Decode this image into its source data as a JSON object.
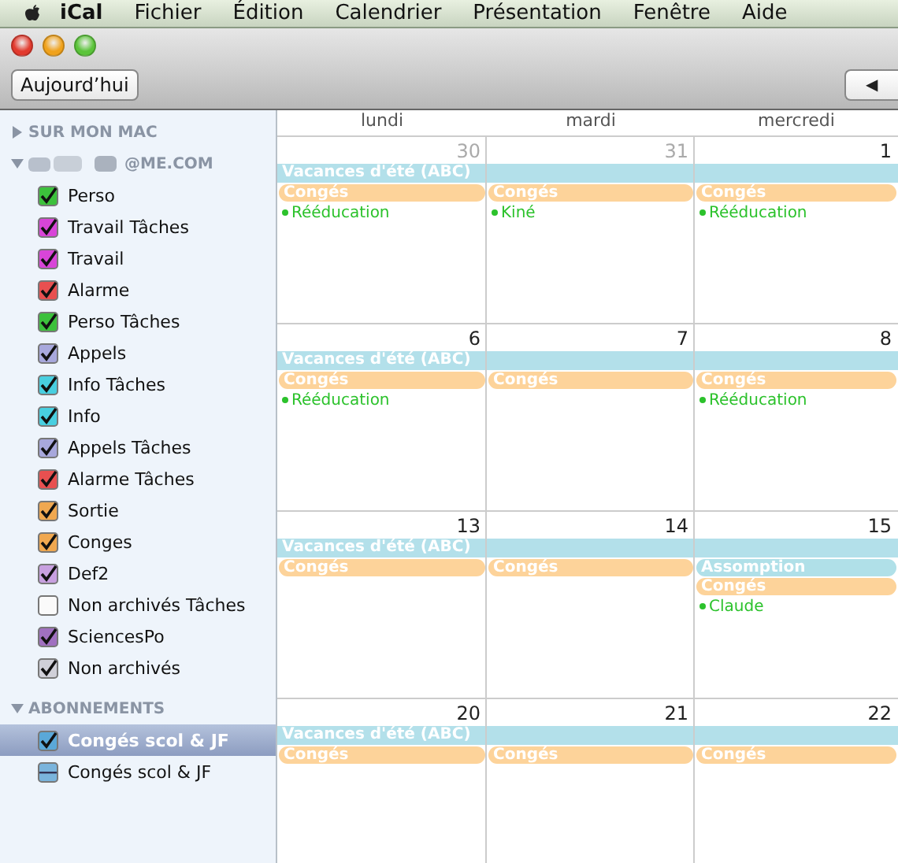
{
  "menubar": {
    "app": "iCal",
    "items": [
      "Fichier",
      "Édition",
      "Calendrier",
      "Présentation",
      "Fenêtre",
      "Aide"
    ]
  },
  "toolbar": {
    "today_button": "Aujourd’hui",
    "prev_button": "◀"
  },
  "sidebar": {
    "sections": [
      {
        "title": "SUR MON MAC",
        "expanded": false
      },
      {
        "title": "@ME.COM",
        "expanded": true,
        "redacted": true,
        "items": [
          {
            "label": "Perso",
            "color": "#3cc13c",
            "checked": true,
            "selected": false
          },
          {
            "label": "Travail Tâches",
            "color": "#d845d8",
            "checked": true,
            "selected": false
          },
          {
            "label": "Travail",
            "color": "#d845d8",
            "checked": true,
            "selected": false
          },
          {
            "label": "Alarme",
            "color": "#e85050",
            "checked": true,
            "selected": false
          },
          {
            "label": "Perso Tâches",
            "color": "#3cc13c",
            "checked": true,
            "selected": false
          },
          {
            "label": "Appels",
            "color": "#a8a8dc",
            "checked": true,
            "selected": false
          },
          {
            "label": "Info Tâches",
            "color": "#48cfe0",
            "checked": true,
            "selected": false
          },
          {
            "label": "Info",
            "color": "#48cfe0",
            "checked": true,
            "selected": false
          },
          {
            "label": "Appels Tâches",
            "color": "#a8a8dc",
            "checked": true,
            "selected": false
          },
          {
            "label": "Alarme Tâches",
            "color": "#e85050",
            "checked": true,
            "selected": false
          },
          {
            "label": "Sortie",
            "color": "#f0a850",
            "checked": true,
            "selected": false
          },
          {
            "label": "Conges",
            "color": "#f0a850",
            "checked": true,
            "selected": false
          },
          {
            "label": "Def2",
            "color": "#c8a0e0",
            "checked": true,
            "selected": false
          },
          {
            "label": "Non archivés Tâches",
            "checked": false,
            "selected": false
          },
          {
            "label": "SciencesPo",
            "color": "#a070c0",
            "checked": true,
            "selected": false
          },
          {
            "label": "Non archivés",
            "color": "#d0d0d8",
            "checked": true,
            "selected": false
          }
        ]
      },
      {
        "title": "ABONNEMENTS",
        "expanded": true,
        "items": [
          {
            "label": "Congés scol & JF",
            "color": "#5aa8d8",
            "checked": true,
            "selected": true
          },
          {
            "label": "Congés scol & JF",
            "color": "#7ab4dc",
            "checked": false,
            "mixed": true,
            "selected": false
          }
        ]
      }
    ]
  },
  "calendar": {
    "weekdays": [
      "lundi",
      "mardi",
      "mercredi"
    ],
    "weeks": [
      {
        "banner": "Vacances d'été (ABC)",
        "days": [
          {
            "number": "30",
            "muted": true,
            "events": [
              {
                "kind": "allday",
                "title": "Congés",
                "color": "#fdd39a"
              },
              {
                "kind": "timed",
                "title": "Rééducation",
                "color": "#2cc22c"
              }
            ]
          },
          {
            "number": "31",
            "muted": true,
            "events": [
              {
                "kind": "allday",
                "title": "Congés",
                "color": "#fdd39a"
              },
              {
                "kind": "timed",
                "title": "Kiné",
                "color": "#2cc22c"
              }
            ]
          },
          {
            "number": "1",
            "muted": false,
            "events": [
              {
                "kind": "allday",
                "title": "Congés",
                "color": "#fdd39a"
              },
              {
                "kind": "timed",
                "title": "Rééducation",
                "color": "#2cc22c"
              }
            ]
          }
        ]
      },
      {
        "banner": "Vacances d'été (ABC)",
        "days": [
          {
            "number": "6",
            "muted": false,
            "events": [
              {
                "kind": "allday",
                "title": "Congés",
                "color": "#fdd39a"
              },
              {
                "kind": "timed",
                "title": "Rééducation",
                "color": "#2cc22c"
              }
            ]
          },
          {
            "number": "7",
            "muted": false,
            "events": [
              {
                "kind": "allday",
                "title": "Congés",
                "color": "#fdd39a"
              }
            ]
          },
          {
            "number": "8",
            "muted": false,
            "events": [
              {
                "kind": "allday",
                "title": "Congés",
                "color": "#fdd39a"
              },
              {
                "kind": "timed",
                "title": "Rééducation",
                "color": "#2cc22c"
              }
            ]
          }
        ]
      },
      {
        "banner": "Vacances d'été (ABC)",
        "days": [
          {
            "number": "13",
            "muted": false,
            "events": [
              {
                "kind": "allday",
                "title": "Congés",
                "color": "#fdd39a"
              }
            ]
          },
          {
            "number": "14",
            "muted": false,
            "events": [
              {
                "kind": "allday",
                "title": "Congés",
                "color": "#fdd39a"
              }
            ]
          },
          {
            "number": "15",
            "muted": false,
            "events": [
              {
                "kind": "allday",
                "title": "Assomption",
                "color": "#b0e0e8"
              },
              {
                "kind": "allday",
                "title": "Congés",
                "color": "#fdd39a"
              },
              {
                "kind": "timed",
                "title": "Claude",
                "color": "#2cc22c"
              }
            ]
          }
        ]
      },
      {
        "banner": "Vacances d'été (ABC)",
        "days": [
          {
            "number": "20",
            "muted": false,
            "events": [
              {
                "kind": "allday",
                "title": "Congés",
                "color": "#fdd39a"
              }
            ]
          },
          {
            "number": "21",
            "muted": false,
            "events": [
              {
                "kind": "allday",
                "title": "Congés",
                "color": "#fdd39a"
              }
            ]
          },
          {
            "number": "22",
            "muted": false,
            "events": [
              {
                "kind": "allday",
                "title": "Congés",
                "color": "#fdd39a"
              }
            ]
          }
        ]
      }
    ]
  }
}
